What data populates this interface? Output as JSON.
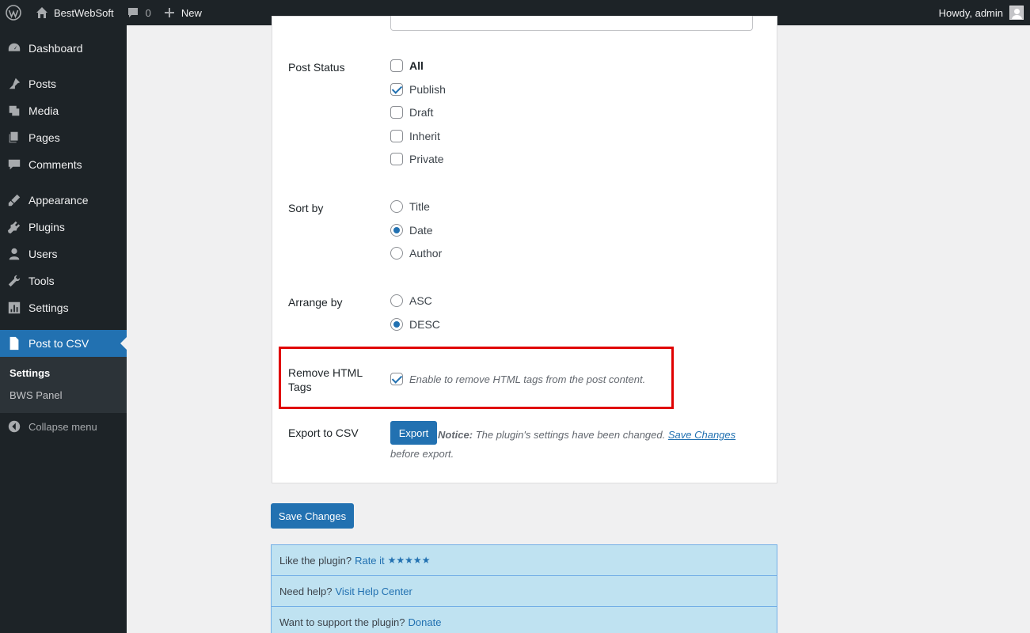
{
  "adminbar": {
    "site_name": "BestWebSoft",
    "comments_count": "0",
    "new_label": "New",
    "howdy": "Howdy, admin"
  },
  "menu": {
    "items": [
      {
        "label": "Dashboard",
        "icon": "dashboard-icon"
      },
      {
        "label": "Posts",
        "icon": "pin-icon"
      },
      {
        "label": "Media",
        "icon": "media-icon"
      },
      {
        "label": "Pages",
        "icon": "pages-icon"
      },
      {
        "label": "Comments",
        "icon": "comment-icon"
      },
      {
        "label": "Appearance",
        "icon": "brush-icon"
      },
      {
        "label": "Plugins",
        "icon": "plugin-icon"
      },
      {
        "label": "Users",
        "icon": "user-icon"
      },
      {
        "label": "Tools",
        "icon": "wrench-icon"
      },
      {
        "label": "Settings",
        "icon": "settings-icon"
      },
      {
        "label": "Post to CSV",
        "icon": "csv-file-icon"
      }
    ],
    "submenu": [
      "Settings",
      "BWS Panel"
    ],
    "collapse": "Collapse menu"
  },
  "form": {
    "post_status": {
      "label": "Post Status",
      "options": [
        "All",
        "Publish",
        "Draft",
        "Inherit",
        "Private"
      ]
    },
    "sort_by": {
      "label": "Sort by",
      "options": [
        "Title",
        "Date",
        "Author"
      ]
    },
    "arrange_by": {
      "label": "Arrange by",
      "options": [
        "ASC",
        "DESC"
      ]
    },
    "remove_html": {
      "label_line1": "Remove HTML",
      "label_line2": "Tags",
      "description": "Enable to remove HTML tags from the post content."
    },
    "export": {
      "label": "Export to CSV",
      "button": "Export",
      "notice_bold": "Notice:",
      "notice_text": "The plugin's settings have been changed.",
      "notice_link": "Save Changes",
      "notice_after": "before",
      "notice_end": "export."
    }
  },
  "save_button": "Save Changes",
  "info": {
    "rate_text": "Like the plugin?",
    "rate_link": "Rate it",
    "stars": "★★★★★",
    "help_text": "Need help?",
    "help_link": "Visit Help Center",
    "donate_text": "Want to support the plugin?",
    "donate_link": "Donate"
  }
}
